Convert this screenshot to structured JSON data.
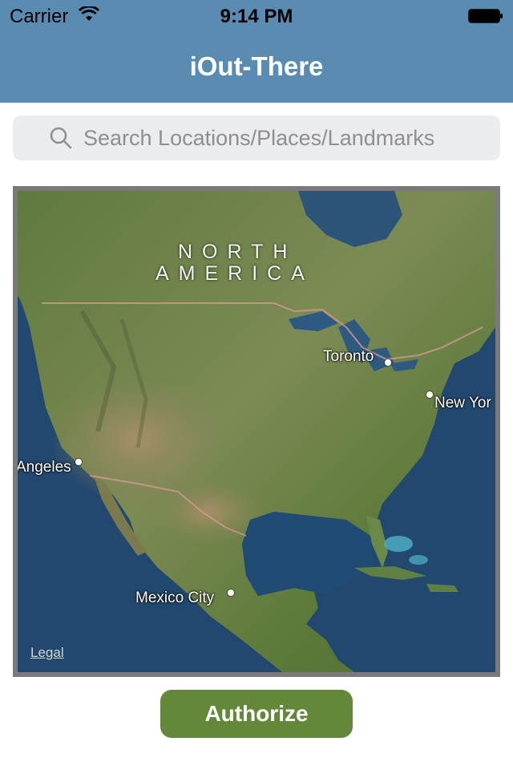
{
  "status_bar": {
    "carrier": "Carrier",
    "time": "9:14 PM"
  },
  "nav": {
    "title": "iOut-There",
    "background_color": "#5a8bb1"
  },
  "search": {
    "placeholder": "Search Locations/Places/Landmarks",
    "value": "",
    "icon": "search-icon"
  },
  "map": {
    "region_label_line1": "NORTH",
    "region_label_line2": "AMERICA",
    "cities": [
      {
        "name": "Toronto"
      },
      {
        "name": "New Yor"
      },
      {
        "name": "Angeles"
      },
      {
        "name": "Mexico City"
      }
    ],
    "legal": "Legal"
  },
  "actions": {
    "authorize_label": "Authorize",
    "authorize_color": "#64883a"
  }
}
